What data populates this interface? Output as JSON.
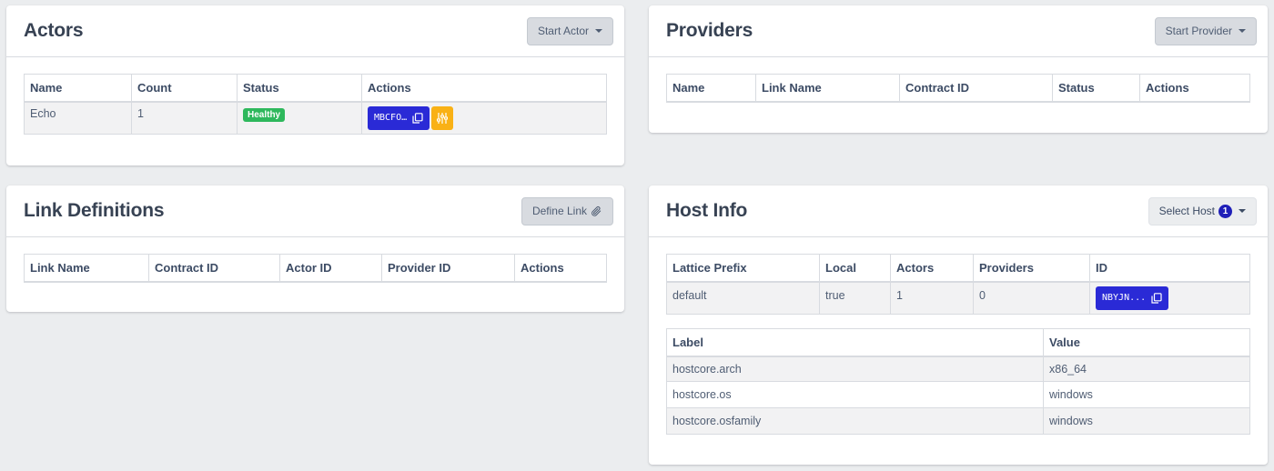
{
  "actors": {
    "title": "Actors",
    "start_button": "Start Actor",
    "columns": [
      "Name",
      "Count",
      "Status",
      "Actions"
    ],
    "rows": [
      {
        "name": "Echo",
        "count": "1",
        "status": "Healthy",
        "id_label": "MBCFO…"
      }
    ]
  },
  "providers": {
    "title": "Providers",
    "start_button": "Start Provider",
    "columns": [
      "Name",
      "Link Name",
      "Contract ID",
      "Status",
      "Actions"
    ]
  },
  "links": {
    "title": "Link Definitions",
    "define_button": "Define Link",
    "columns": [
      "Link Name",
      "Contract ID",
      "Actor ID",
      "Provider ID",
      "Actions"
    ]
  },
  "host": {
    "title": "Host Info",
    "select_button": "Select Host",
    "host_count": "1",
    "columns": [
      "Lattice Prefix",
      "Local",
      "Actors",
      "Providers",
      "ID"
    ],
    "row": {
      "prefix": "default",
      "local": "true",
      "actors": "1",
      "providers": "0",
      "id_label": "NBYJN..."
    },
    "label_columns": [
      "Label",
      "Value"
    ],
    "labels": [
      {
        "label": "hostcore.arch",
        "value": "x86_64"
      },
      {
        "label": "hostcore.os",
        "value": "windows"
      },
      {
        "label": "hostcore.osfamily",
        "value": "windows"
      }
    ]
  },
  "colors": {
    "primary": "#2a2ad6",
    "warning": "#f9b115",
    "success": "#2eb85c",
    "background": "#ebedef"
  },
  "icons": {
    "copy": "copy-icon",
    "sliders": "sliders-icon",
    "paperclip": "paperclip-icon",
    "caret": "caret-down-icon"
  }
}
